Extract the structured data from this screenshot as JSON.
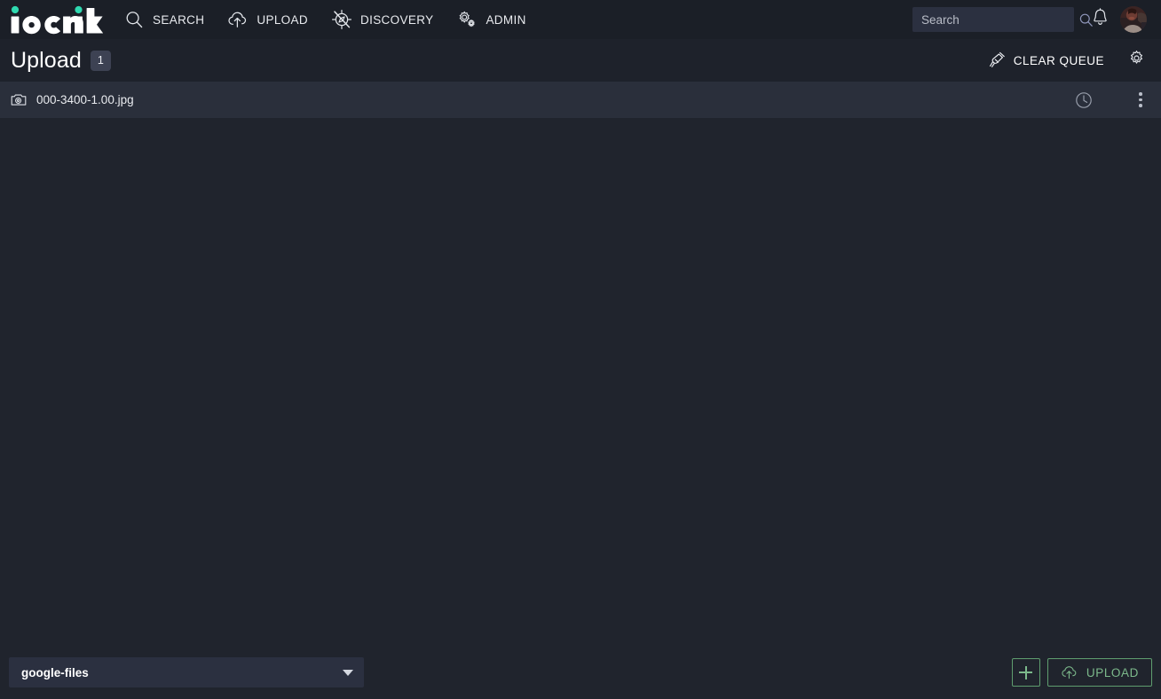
{
  "brand": {
    "logo_text": "iconik",
    "accent_color": "#2fd9b0"
  },
  "topnav": {
    "items": [
      {
        "label": "SEARCH",
        "icon": "search-icon"
      },
      {
        "label": "UPLOAD",
        "icon": "cloud-upload-icon"
      },
      {
        "label": "DISCOVERY",
        "icon": "compass-disabled-icon"
      },
      {
        "label": "ADMIN",
        "icon": "gears-icon"
      }
    ],
    "search": {
      "placeholder": "Search",
      "value": "",
      "icon": "search-icon"
    },
    "notifications_icon": "bell-icon",
    "avatar_name": "user-avatar"
  },
  "page": {
    "title": "Upload",
    "count_badge": "1",
    "clear_queue": {
      "label": "CLEAR QUEUE",
      "icon": "broom-icon"
    },
    "settings_icon": "gear-icon"
  },
  "queue": {
    "files": [
      {
        "name": "000-3400-1.00.jpg",
        "type_icon": "photo-camera-icon",
        "status_icon": "clock-pending-icon",
        "menu_icon": "kebab-menu-icon"
      }
    ]
  },
  "footer": {
    "storage": {
      "selected": "google-files",
      "caret_icon": "chevron-down-icon"
    },
    "add_button": {
      "label": "+",
      "icon": "plus-icon"
    },
    "upload_button": {
      "label": "UPLOAD",
      "icon": "cloud-upload-icon"
    },
    "accent_color": "#7cb98b"
  },
  "colors": {
    "topbar_bg": "#1b1f27",
    "header_bg": "#1e222b",
    "body_bg": "#20242d",
    "row_bg": "#2a2f3b",
    "field_bg": "#2b3040",
    "badge_bg": "#3d4253"
  }
}
